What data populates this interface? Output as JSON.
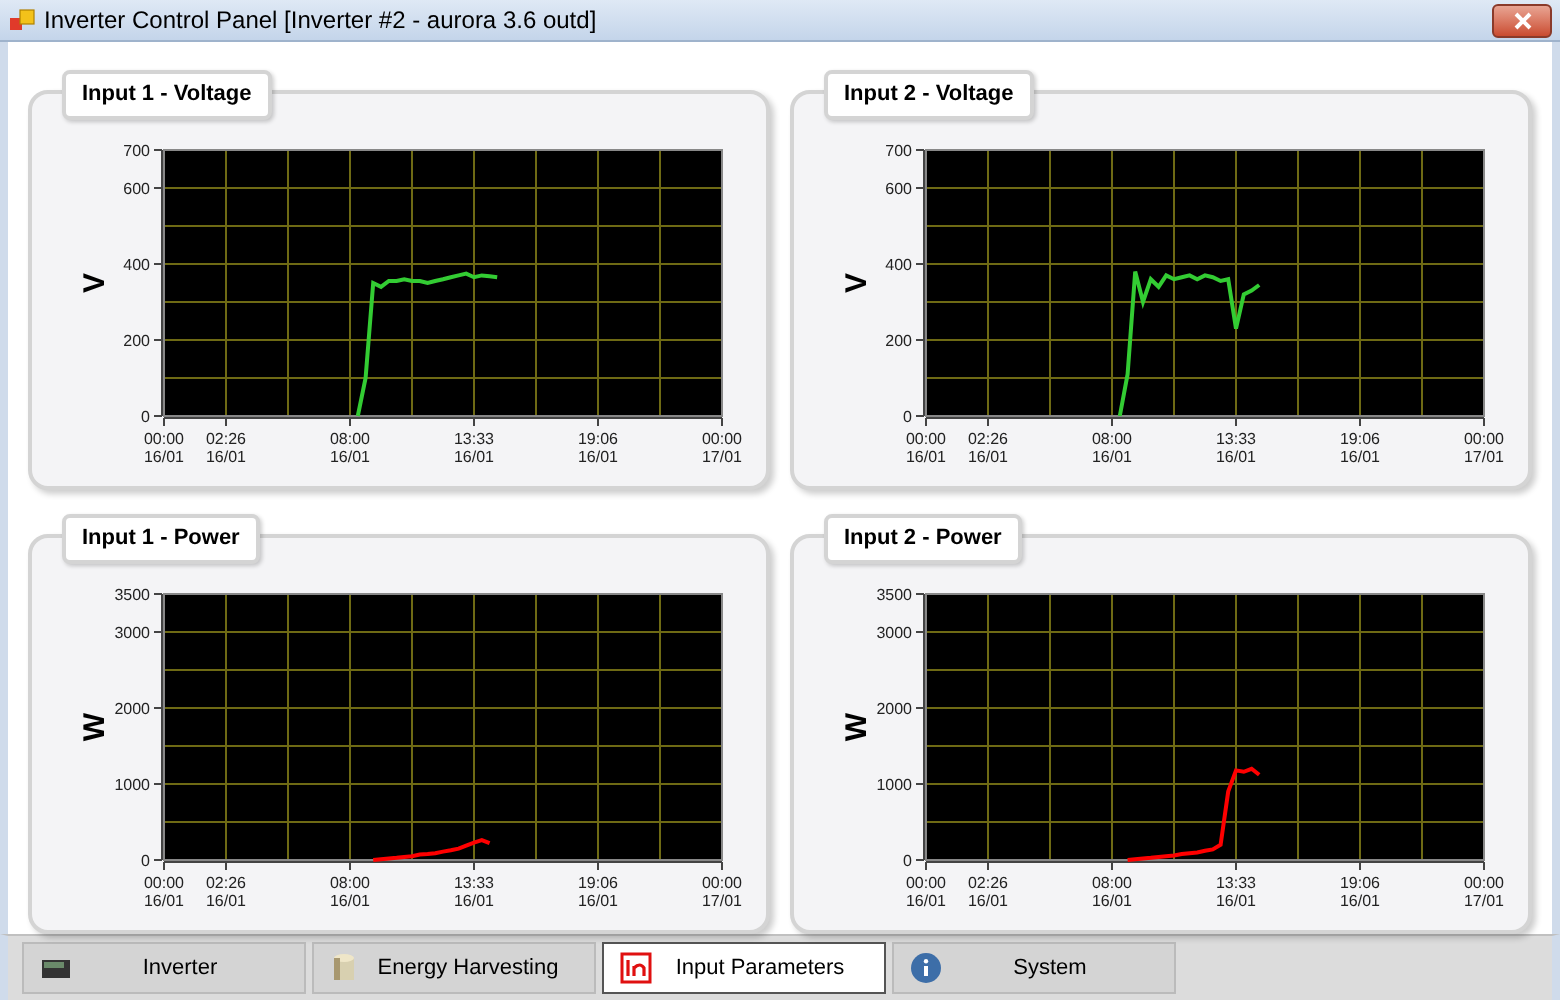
{
  "window": {
    "title": "Inverter Control Panel [Inverter #2 - aurora 3.6 outd]"
  },
  "panels": [
    {
      "title": "Input 1 - Voltage",
      "chart_data": {
        "type": "line",
        "ylabel": "V",
        "ylim": [
          0,
          700
        ],
        "grid": true,
        "yticks": [
          0,
          200,
          400,
          600,
          700
        ],
        "categories": [
          "00:00 16/01",
          null,
          null,
          null,
          null,
          null,
          null,
          null,
          "02:26 16/01",
          null,
          null,
          null,
          null,
          null,
          null,
          null,
          null,
          null,
          null,
          null,
          null,
          null,
          null,
          null,
          "08:00 16/01",
          null,
          null,
          null,
          null,
          null,
          null,
          null,
          null,
          null,
          null,
          null,
          null,
          null,
          null,
          null,
          "13:33 16/01",
          null,
          null,
          null,
          null,
          null,
          null,
          null,
          null,
          null,
          null,
          null,
          null,
          null,
          null,
          null,
          "19:06 16/01",
          null,
          null,
          null,
          null,
          null,
          null,
          null,
          null,
          null,
          null,
          null,
          null,
          null,
          null,
          null,
          "00:00 17/01"
        ],
        "series": [
          {
            "color": "#33cc33",
            "values": [
              null,
              null,
              null,
              null,
              null,
              null,
              null,
              null,
              null,
              null,
              null,
              null,
              null,
              null,
              null,
              null,
              null,
              null,
              null,
              null,
              null,
              null,
              null,
              null,
              null,
              0,
              100,
              350,
              340,
              355,
              355,
              360,
              355,
              355,
              350,
              355,
              360,
              365,
              370,
              375,
              365,
              370,
              368,
              365,
              null,
              null,
              null,
              null,
              null,
              null,
              null,
              null,
              null,
              null,
              null,
              null,
              null,
              null,
              null,
              null,
              null,
              null,
              null,
              null,
              null,
              null,
              null,
              null,
              null,
              null,
              null,
              null,
              null
            ]
          }
        ]
      }
    },
    {
      "title": "Input 2 - Voltage",
      "chart_data": {
        "type": "line",
        "ylabel": "V",
        "ylim": [
          0,
          700
        ],
        "grid": true,
        "yticks": [
          0,
          200,
          400,
          600,
          700
        ],
        "categories": [
          "00:00 16/01",
          null,
          null,
          null,
          null,
          null,
          null,
          null,
          "02:26 16/01",
          null,
          null,
          null,
          null,
          null,
          null,
          null,
          null,
          null,
          null,
          null,
          null,
          null,
          null,
          null,
          "08:00 16/01",
          null,
          null,
          null,
          null,
          null,
          null,
          null,
          null,
          null,
          null,
          null,
          null,
          null,
          null,
          null,
          "13:33 16/01",
          null,
          null,
          null,
          null,
          null,
          null,
          null,
          null,
          null,
          null,
          null,
          null,
          null,
          null,
          null,
          "19:06 16/01",
          null,
          null,
          null,
          null,
          null,
          null,
          null,
          null,
          null,
          null,
          null,
          null,
          null,
          null,
          null,
          "00:00 17/01"
        ],
        "series": [
          {
            "color": "#33cc33",
            "values": [
              null,
              null,
              null,
              null,
              null,
              null,
              null,
              null,
              null,
              null,
              null,
              null,
              null,
              null,
              null,
              null,
              null,
              null,
              null,
              null,
              null,
              null,
              null,
              null,
              null,
              0,
              110,
              380,
              300,
              360,
              340,
              370,
              360,
              365,
              370,
              360,
              370,
              365,
              355,
              360,
              230,
              320,
              330,
              345,
              null,
              null,
              null,
              null,
              null,
              null,
              null,
              null,
              null,
              null,
              null,
              null,
              null,
              null,
              null,
              null,
              null,
              null,
              null,
              null,
              null,
              null,
              null,
              null,
              null,
              null,
              null,
              null,
              null
            ]
          }
        ]
      }
    },
    {
      "title": "Input 1 - Power",
      "chart_data": {
        "type": "line",
        "ylabel": "W",
        "ylim": [
          0,
          3500
        ],
        "grid": true,
        "yticks": [
          0,
          1000,
          2000,
          3000,
          3500
        ],
        "categories": [
          "00:00 16/01",
          null,
          null,
          null,
          null,
          null,
          null,
          null,
          "02:26 16/01",
          null,
          null,
          null,
          null,
          null,
          null,
          null,
          null,
          null,
          null,
          null,
          null,
          null,
          null,
          null,
          "08:00 16/01",
          null,
          null,
          null,
          null,
          null,
          null,
          null,
          null,
          null,
          null,
          null,
          null,
          null,
          null,
          null,
          "13:33 16/01",
          null,
          null,
          null,
          null,
          null,
          null,
          null,
          null,
          null,
          null,
          null,
          null,
          null,
          null,
          null,
          "19:06 16/01",
          null,
          null,
          null,
          null,
          null,
          null,
          null,
          null,
          null,
          null,
          null,
          null,
          null,
          null,
          null,
          "00:00 17/01"
        ],
        "series": [
          {
            "color": "#ff0000",
            "values": [
              null,
              null,
              null,
              null,
              null,
              null,
              null,
              null,
              null,
              null,
              null,
              null,
              null,
              null,
              null,
              null,
              null,
              null,
              null,
              null,
              null,
              null,
              null,
              null,
              null,
              null,
              null,
              0,
              10,
              20,
              30,
              40,
              50,
              70,
              80,
              90,
              110,
              130,
              150,
              190,
              230,
              260,
              220,
              null,
              null,
              null,
              null,
              null,
              null,
              null,
              null,
              null,
              null,
              null,
              null,
              null,
              null,
              null,
              null,
              null,
              null,
              null,
              null,
              null,
              null,
              null,
              null,
              null,
              null,
              null,
              null,
              null,
              null
            ]
          }
        ]
      }
    },
    {
      "title": "Input 2 - Power",
      "chart_data": {
        "type": "line",
        "ylabel": "W",
        "ylim": [
          0,
          3500
        ],
        "grid": true,
        "yticks": [
          0,
          1000,
          2000,
          3000,
          3500
        ],
        "categories": [
          "00:00 16/01",
          null,
          null,
          null,
          null,
          null,
          null,
          null,
          "02:26 16/01",
          null,
          null,
          null,
          null,
          null,
          null,
          null,
          null,
          null,
          null,
          null,
          null,
          null,
          null,
          null,
          "08:00 16/01",
          null,
          null,
          null,
          null,
          null,
          null,
          null,
          null,
          null,
          null,
          null,
          null,
          null,
          null,
          null,
          "13:33 16/01",
          null,
          null,
          null,
          null,
          null,
          null,
          null,
          null,
          null,
          null,
          null,
          null,
          null,
          null,
          null,
          "19:06 16/01",
          null,
          null,
          null,
          null,
          null,
          null,
          null,
          null,
          null,
          null,
          null,
          null,
          null,
          null,
          null,
          "00:00 17/01"
        ],
        "series": [
          {
            "color": "#ff0000",
            "values": [
              null,
              null,
              null,
              null,
              null,
              null,
              null,
              null,
              null,
              null,
              null,
              null,
              null,
              null,
              null,
              null,
              null,
              null,
              null,
              null,
              null,
              null,
              null,
              null,
              null,
              null,
              0,
              10,
              20,
              30,
              40,
              50,
              60,
              80,
              90,
              100,
              120,
              140,
              200,
              900,
              1180,
              1160,
              1200,
              1120,
              null,
              null,
              null,
              null,
              null,
              null,
              null,
              null,
              null,
              null,
              null,
              null,
              null,
              null,
              null,
              null,
              null,
              null,
              null,
              null,
              null,
              null,
              null,
              null,
              null,
              null,
              null,
              null,
              null
            ]
          }
        ]
      }
    }
  ],
  "tabs": [
    {
      "label": "Inverter",
      "kind": "inverter",
      "selected": false
    },
    {
      "label": "Energy Harvesting",
      "kind": "energy",
      "selected": false
    },
    {
      "label": "Input Parameters",
      "kind": "input",
      "selected": true
    },
    {
      "label": "System",
      "kind": "system",
      "selected": false
    }
  ]
}
